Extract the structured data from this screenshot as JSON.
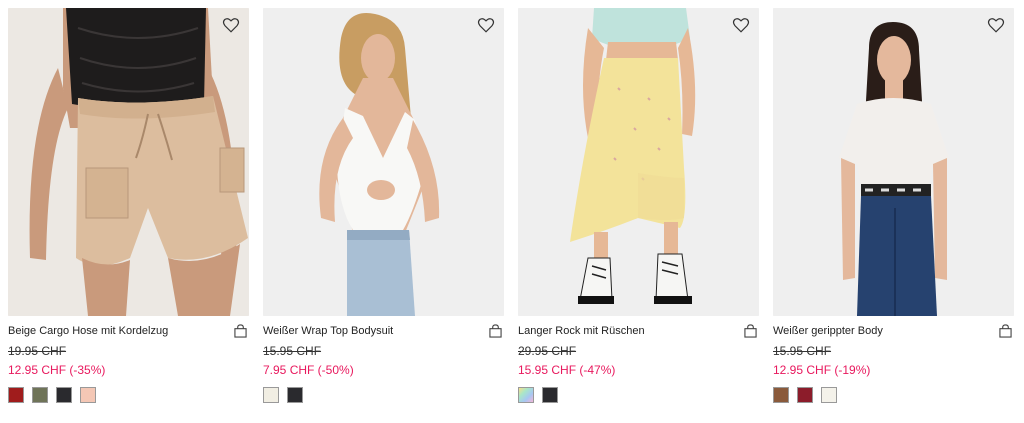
{
  "products": [
    {
      "title": "Beige Cargo Hose mit Kordelzug",
      "old_price": "19.95 CHF",
      "new_price": "12.95 CHF (-35%)",
      "photo_bg": "#ece8e3",
      "swatches": [
        "#a01c1c",
        "#6f7458",
        "#2a2a2e",
        "#f4c7b5"
      ]
    },
    {
      "title": "Weißer Wrap Top Bodysuit",
      "old_price": "15.95 CHF",
      "new_price": "7.95 CHF (-50%)",
      "photo_bg": "#efefef",
      "swatches": [
        "#f1eee3",
        "#2a2a2e"
      ]
    },
    {
      "title": "Langer Rock mit Rüschen",
      "old_price": "29.95 CHF",
      "new_price": "15.95 CHF (-47%)",
      "photo_bg": "#efefef",
      "swatches": [
        "multicolor",
        "#2a2a2e"
      ]
    },
    {
      "title": "Weißer gerippter Body",
      "old_price": "15.95 CHF",
      "new_price": "12.95 CHF (-19%)",
      "photo_bg": "#efefef",
      "swatches": [
        "#8a5a3b",
        "#8c1c2a",
        "#f4f2ea"
      ]
    }
  ],
  "colors": {
    "sale": "#e8185d",
    "text": "#222222"
  },
  "icons": {
    "wishlist": "heart-icon",
    "cart": "shopping-bag-icon"
  }
}
